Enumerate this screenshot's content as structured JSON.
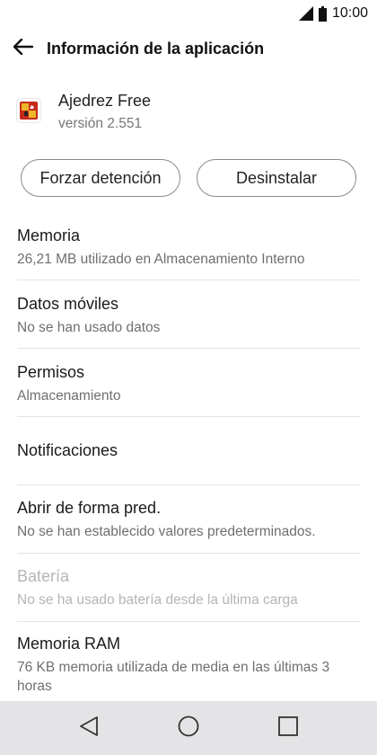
{
  "status_bar": {
    "time": "10:00",
    "signal_icon": "signal-icon",
    "battery_icon": "battery-icon"
  },
  "toolbar": {
    "back_icon": "arrow-left-icon",
    "title": "Información de la aplicación"
  },
  "app": {
    "name": "Ajedrez Free",
    "version": "versión 2.551",
    "icon": "chess-app-icon"
  },
  "buttons": {
    "force_stop": "Forzar detención",
    "uninstall": "Desinstalar"
  },
  "settings": [
    {
      "title": "Memoria",
      "subtitle": "26,21 MB utilizado en Almacenamiento Interno",
      "enabled": true
    },
    {
      "title": "Datos móviles",
      "subtitle": "No se han usado datos",
      "enabled": true
    },
    {
      "title": "Permisos",
      "subtitle": "Almacenamiento",
      "enabled": true
    },
    {
      "title": "Notificaciones",
      "subtitle": "",
      "enabled": true
    },
    {
      "title": "Abrir de forma pred.",
      "subtitle": "No se han establecido valores predeterminados.",
      "enabled": true
    },
    {
      "title": "Batería",
      "subtitle": "No se ha usado batería desde la última carga",
      "enabled": false
    },
    {
      "title": "Memoria RAM",
      "subtitle": "76 KB memoria utilizada de media en las últimas 3 horas",
      "enabled": true
    }
  ],
  "nav_bar": {
    "back_icon": "triangle-back-icon",
    "home_icon": "circle-home-icon",
    "recent_icon": "square-recents-icon"
  },
  "colors": {
    "nav_bar_bg": "#e4e4e6",
    "divider": "#e3e3e3",
    "disabled_text": "#b5b5b5",
    "secondary_text": "#6f6f6f"
  }
}
